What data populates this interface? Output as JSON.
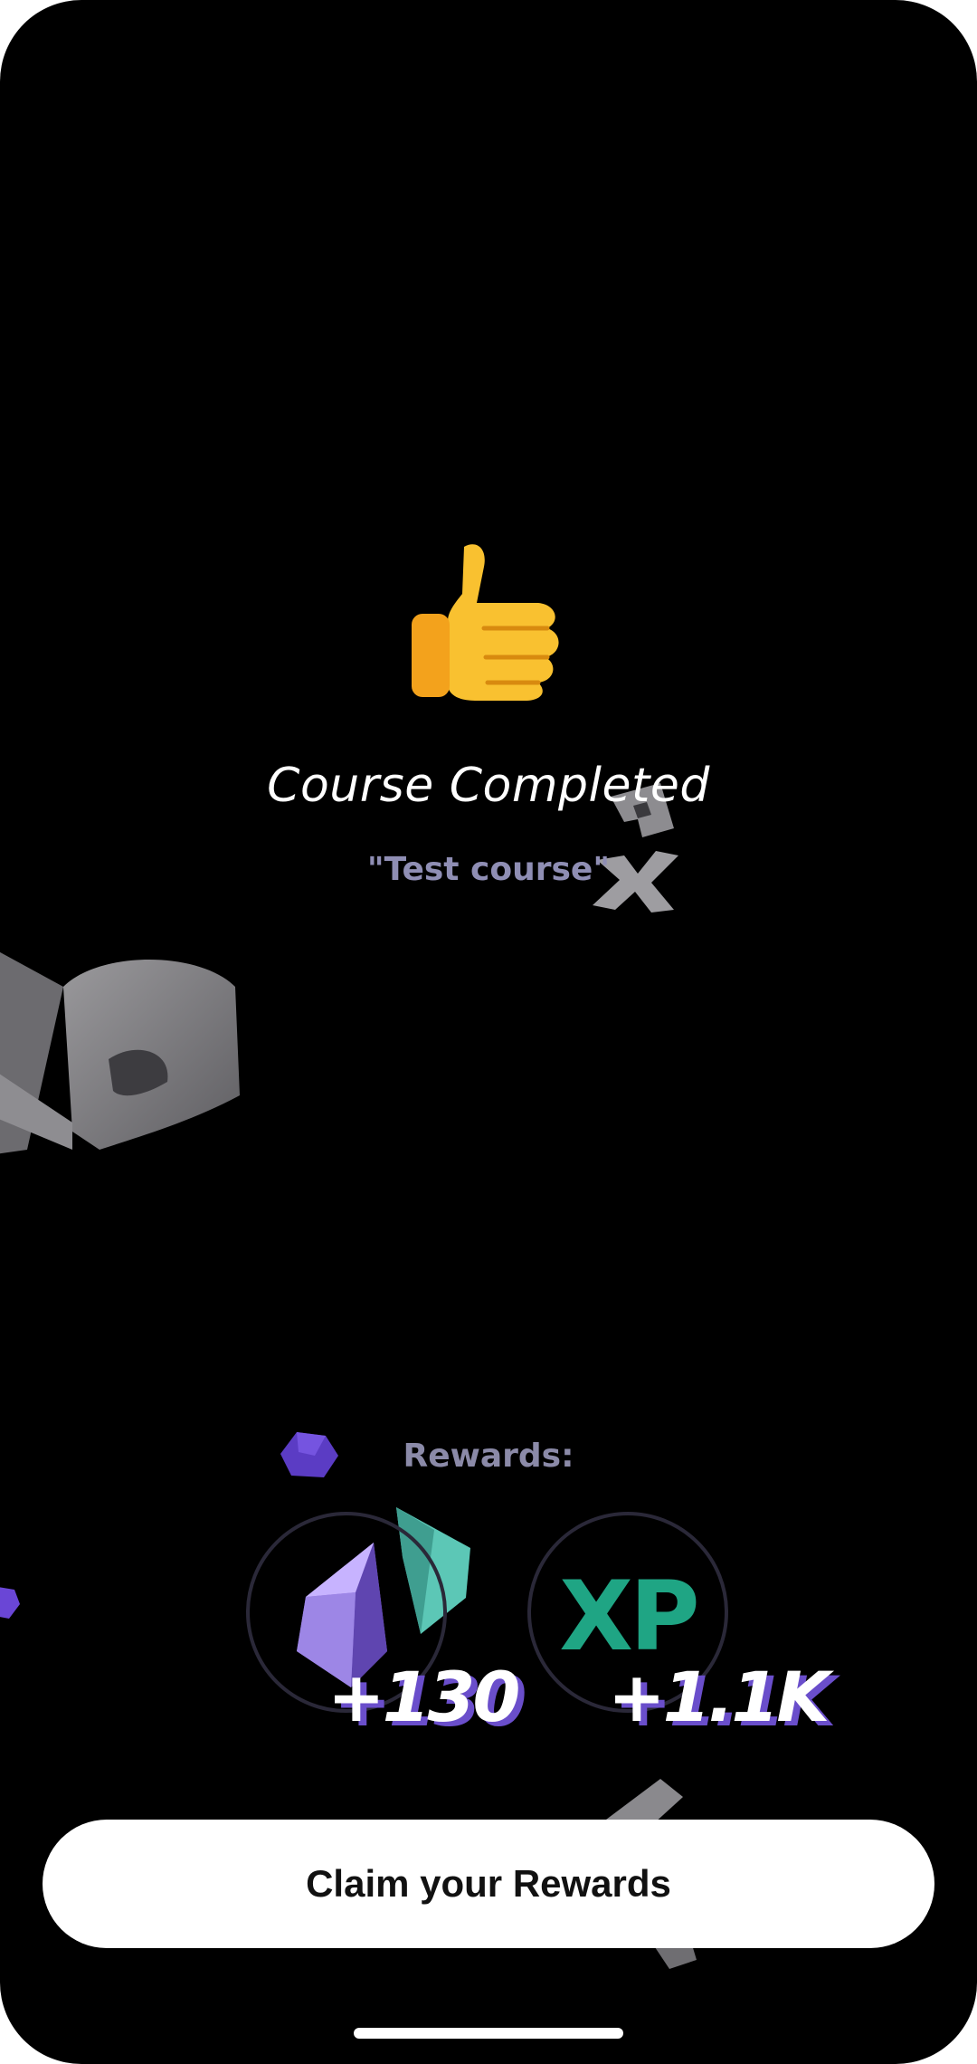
{
  "completion": {
    "emoji_icon": "thumbs-up-icon",
    "emoji": "👍",
    "title": "Course Completed",
    "course_name": "\"Test course\""
  },
  "rewards": {
    "label": "Rewards:",
    "items": [
      {
        "icon": "gem-icon",
        "amount": "+130"
      },
      {
        "icon": "xp-icon",
        "icon_text": "XP",
        "amount": "+1.1K"
      }
    ]
  },
  "actions": {
    "claim_label": "Claim your Rewards"
  },
  "colors": {
    "background": "#000000",
    "subtitle": "#8f8eb4",
    "xp_green": "#1fa584",
    "gem_purple": "#8a6fd6",
    "amount_shadow": "#6a4ecb",
    "button_bg": "#ffffff"
  }
}
